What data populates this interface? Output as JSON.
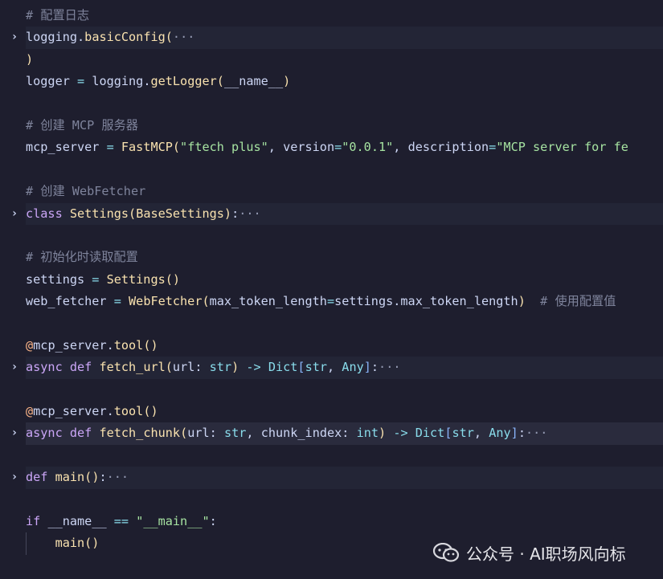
{
  "editor": {
    "colors": {
      "background": "#1e1e2e",
      "fold_line_bg": "#232536",
      "active_line_bg": "#2a2b3d",
      "comment": "#7f849c",
      "keyword": "#cba6f7",
      "function": "#f9e2af",
      "string": "#a6e3a1",
      "operator": "#89dceb",
      "decorator": "#fab387",
      "parameter": "#eba0ac"
    },
    "lines": [
      {
        "folded": false,
        "tokens": [
          {
            "t": "# 配置日志",
            "c": "comment"
          }
        ]
      },
      {
        "folded": true,
        "tokens": [
          {
            "t": "logging",
            "c": "default"
          },
          {
            "t": ".",
            "c": "default"
          },
          {
            "t": "basicConfig",
            "c": "fn"
          },
          {
            "t": "(",
            "c": "paren"
          },
          {
            "t": "···",
            "c": "ellipsis"
          }
        ]
      },
      {
        "folded": false,
        "tokens": [
          {
            "t": ")",
            "c": "paren"
          }
        ]
      },
      {
        "folded": false,
        "tokens": [
          {
            "t": "logger",
            "c": "default"
          },
          {
            "t": " = ",
            "c": "op"
          },
          {
            "t": "logging",
            "c": "default"
          },
          {
            "t": ".",
            "c": "default"
          },
          {
            "t": "getLogger",
            "c": "fn"
          },
          {
            "t": "(",
            "c": "paren"
          },
          {
            "t": "__name__",
            "c": "default"
          },
          {
            "t": ")",
            "c": "paren"
          }
        ]
      },
      {
        "folded": false,
        "tokens": []
      },
      {
        "folded": false,
        "tokens": [
          {
            "t": "# 创建 MCP 服务器",
            "c": "comment"
          }
        ]
      },
      {
        "folded": false,
        "tokens": [
          {
            "t": "mcp_server",
            "c": "default"
          },
          {
            "t": " = ",
            "c": "op"
          },
          {
            "t": "FastMCP",
            "c": "fn"
          },
          {
            "t": "(",
            "c": "paren"
          },
          {
            "t": "\"ftech plus\"",
            "c": "str"
          },
          {
            "t": ", ",
            "c": "default"
          },
          {
            "t": "version",
            "c": "default"
          },
          {
            "t": "=",
            "c": "op"
          },
          {
            "t": "\"0.0.1\"",
            "c": "str"
          },
          {
            "t": ", ",
            "c": "default"
          },
          {
            "t": "description",
            "c": "default"
          },
          {
            "t": "=",
            "c": "op"
          },
          {
            "t": "\"MCP server for fe",
            "c": "str"
          }
        ]
      },
      {
        "folded": false,
        "tokens": []
      },
      {
        "folded": false,
        "tokens": [
          {
            "t": "# 创建 WebFetcher",
            "c": "comment"
          }
        ]
      },
      {
        "folded": true,
        "tokens": [
          {
            "t": "class",
            "c": "kw"
          },
          {
            "t": " ",
            "c": "default"
          },
          {
            "t": "Settings",
            "c": "cls"
          },
          {
            "t": "(",
            "c": "paren"
          },
          {
            "t": "BaseSettings",
            "c": "cls"
          },
          {
            "t": ")",
            "c": "paren"
          },
          {
            "t": ":",
            "c": "default"
          },
          {
            "t": "···",
            "c": "ellipsis"
          }
        ]
      },
      {
        "folded": false,
        "tokens": []
      },
      {
        "folded": false,
        "tokens": [
          {
            "t": "# 初始化时读取配置",
            "c": "comment"
          }
        ]
      },
      {
        "folded": false,
        "tokens": [
          {
            "t": "settings",
            "c": "default"
          },
          {
            "t": " = ",
            "c": "op"
          },
          {
            "t": "Settings",
            "c": "fn"
          },
          {
            "t": "()",
            "c": "paren"
          }
        ]
      },
      {
        "folded": false,
        "tokens": [
          {
            "t": "web_fetcher",
            "c": "default"
          },
          {
            "t": " = ",
            "c": "op"
          },
          {
            "t": "WebFetcher",
            "c": "fn"
          },
          {
            "t": "(",
            "c": "paren"
          },
          {
            "t": "max_token_length",
            "c": "default"
          },
          {
            "t": "=",
            "c": "op"
          },
          {
            "t": "settings",
            "c": "default"
          },
          {
            "t": ".",
            "c": "default"
          },
          {
            "t": "max_token_length",
            "c": "default"
          },
          {
            "t": ")",
            "c": "paren"
          },
          {
            "t": "  # 使用配置值",
            "c": "comment"
          }
        ]
      },
      {
        "folded": false,
        "tokens": []
      },
      {
        "folded": false,
        "tokens": [
          {
            "t": "@",
            "c": "dec"
          },
          {
            "t": "mcp_server",
            "c": "default"
          },
          {
            "t": ".",
            "c": "default"
          },
          {
            "t": "tool",
            "c": "fn"
          },
          {
            "t": "()",
            "c": "paren"
          }
        ]
      },
      {
        "folded": true,
        "tokens": [
          {
            "t": "async",
            "c": "kw"
          },
          {
            "t": " ",
            "c": "default"
          },
          {
            "t": "def",
            "c": "kw"
          },
          {
            "t": " ",
            "c": "default"
          },
          {
            "t": "fetch_url",
            "c": "fn"
          },
          {
            "t": "(",
            "c": "paren"
          },
          {
            "t": "url",
            "c": "default"
          },
          {
            "t": ": ",
            "c": "default"
          },
          {
            "t": "str",
            "c": "type"
          },
          {
            "t": ")",
            "c": "paren"
          },
          {
            "t": " -> ",
            "c": "op"
          },
          {
            "t": "Dict",
            "c": "type"
          },
          {
            "t": "[",
            "c": "bracket"
          },
          {
            "t": "str",
            "c": "type"
          },
          {
            "t": ", ",
            "c": "default"
          },
          {
            "t": "Any",
            "c": "type"
          },
          {
            "t": "]",
            "c": "bracket"
          },
          {
            "t": ":",
            "c": "default"
          },
          {
            "t": "···",
            "c": "ellipsis"
          }
        ]
      },
      {
        "folded": false,
        "tokens": []
      },
      {
        "folded": false,
        "tokens": [
          {
            "t": "@",
            "c": "dec"
          },
          {
            "t": "mcp_server",
            "c": "default"
          },
          {
            "t": ".",
            "c": "default"
          },
          {
            "t": "tool",
            "c": "fn"
          },
          {
            "t": "()",
            "c": "paren"
          }
        ]
      },
      {
        "folded": true,
        "active": true,
        "tokens": [
          {
            "t": "async",
            "c": "kw"
          },
          {
            "t": " ",
            "c": "default"
          },
          {
            "t": "def",
            "c": "kw"
          },
          {
            "t": " ",
            "c": "default"
          },
          {
            "t": "fetch_chunk",
            "c": "fn"
          },
          {
            "t": "(",
            "c": "paren"
          },
          {
            "t": "url",
            "c": "default"
          },
          {
            "t": ": ",
            "c": "default"
          },
          {
            "t": "str",
            "c": "type"
          },
          {
            "t": ", ",
            "c": "default"
          },
          {
            "t": "chunk_index",
            "c": "default"
          },
          {
            "t": ": ",
            "c": "default"
          },
          {
            "t": "int",
            "c": "type"
          },
          {
            "t": ")",
            "c": "paren"
          },
          {
            "t": " -> ",
            "c": "op"
          },
          {
            "t": "Dict",
            "c": "type"
          },
          {
            "t": "[",
            "c": "bracket"
          },
          {
            "t": "str",
            "c": "type"
          },
          {
            "t": ", ",
            "c": "default"
          },
          {
            "t": "Any",
            "c": "type"
          },
          {
            "t": "]",
            "c": "bracket"
          },
          {
            "t": ":",
            "c": "default"
          },
          {
            "t": "···",
            "c": "ellipsis"
          }
        ]
      },
      {
        "folded": false,
        "tokens": []
      },
      {
        "folded": true,
        "tokens": [
          {
            "t": "def",
            "c": "kw"
          },
          {
            "t": " ",
            "c": "default"
          },
          {
            "t": "main",
            "c": "fn"
          },
          {
            "t": "()",
            "c": "paren"
          },
          {
            "t": ":",
            "c": "default"
          },
          {
            "t": "···",
            "c": "ellipsis"
          }
        ]
      },
      {
        "folded": false,
        "tokens": []
      },
      {
        "folded": false,
        "tokens": [
          {
            "t": "if",
            "c": "kw"
          },
          {
            "t": " ",
            "c": "default"
          },
          {
            "t": "__name__",
            "c": "default"
          },
          {
            "t": " == ",
            "c": "op"
          },
          {
            "t": "\"__main__\"",
            "c": "str"
          },
          {
            "t": ":",
            "c": "default"
          }
        ]
      },
      {
        "folded": false,
        "indent": true,
        "tokens": [
          {
            "t": "    ",
            "c": "default"
          },
          {
            "t": "main",
            "c": "fn"
          },
          {
            "t": "()",
            "c": "paren"
          }
        ]
      }
    ]
  },
  "watermark": {
    "text": "公众号 · AI职场风向标",
    "icon": "wechat-icon"
  }
}
